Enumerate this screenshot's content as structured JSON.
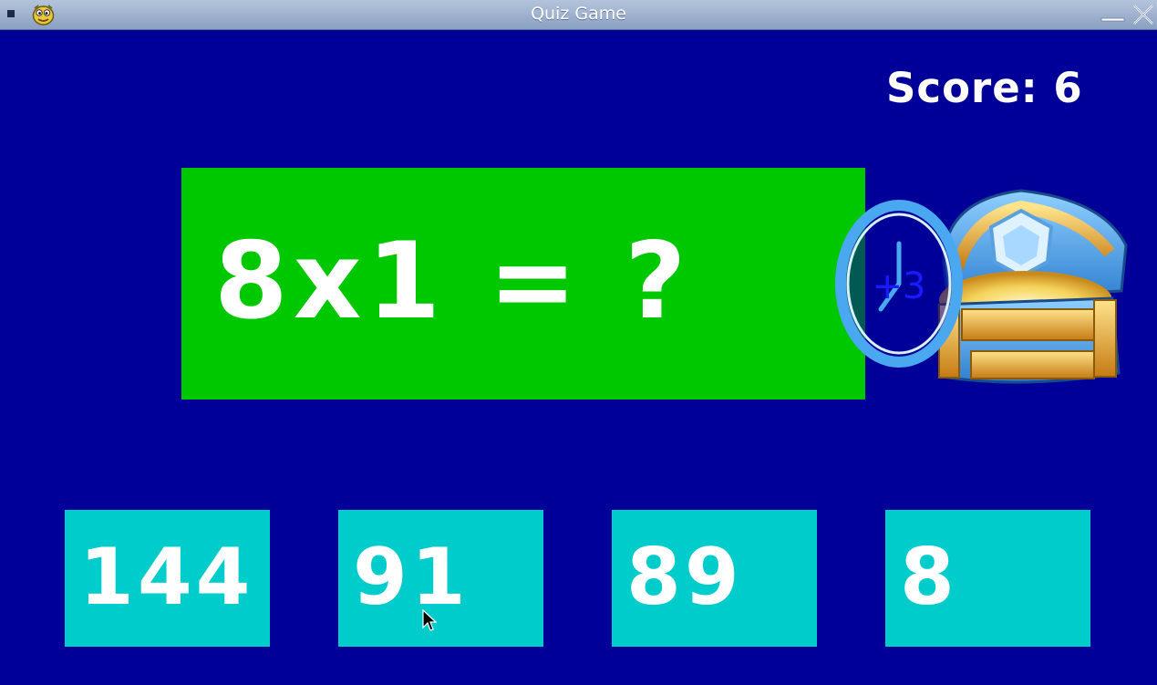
{
  "window": {
    "title": "Quiz Game",
    "app_icon": "pygame-snake-icon",
    "menu_icon": "window-menu-icon",
    "minimize_icon": "minimize-icon",
    "close_icon": "close-icon"
  },
  "game": {
    "score_text": "Score: 6",
    "question": "8x1 = ?",
    "answers": [
      "144",
      "91",
      "89",
      "8"
    ],
    "powerup": {
      "chest_icon": "treasure-chest-icon",
      "clock_icon": "clock-icon",
      "bonus_text": "+3"
    }
  },
  "colors": {
    "background": "#000099",
    "question_bg": "#00c800",
    "answer_bg": "#00cccc",
    "text": "#ffffff"
  }
}
